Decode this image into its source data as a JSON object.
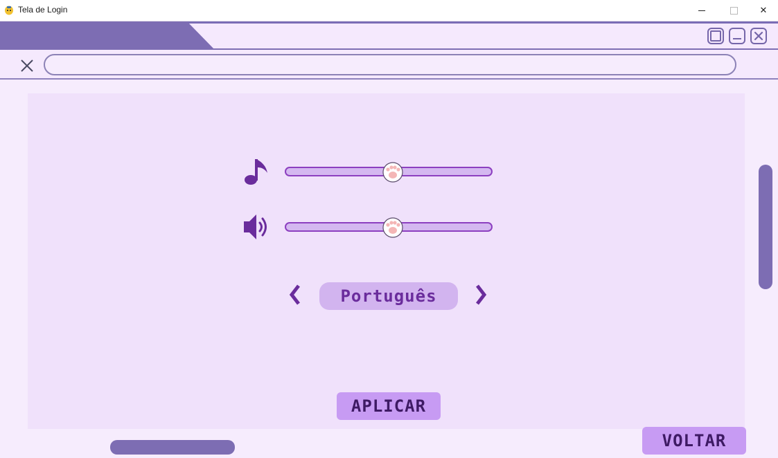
{
  "os_window": {
    "title": "Tela de Login",
    "minimize_glyph": "",
    "maximize_glyph": "",
    "close_glyph": "✕"
  },
  "address_bar": {
    "value": "",
    "placeholder": ""
  },
  "settings": {
    "music_icon": "music-note-icon",
    "sound_icon": "speaker-icon",
    "music_volume": 0.52,
    "sound_volume": 0.52
  },
  "language": {
    "current": "Português",
    "prev_icon": "chevron-left-icon",
    "next_icon": "chevron-right-icon"
  },
  "buttons": {
    "apply_label": "APLICAR",
    "back_label": "VOLTAR"
  },
  "colors": {
    "accent": "#7d6db3",
    "icon": "#6a2c9c",
    "slider_fill": "#d4b8f0",
    "button": "#c79bf3",
    "background": "#f6ecfd"
  }
}
